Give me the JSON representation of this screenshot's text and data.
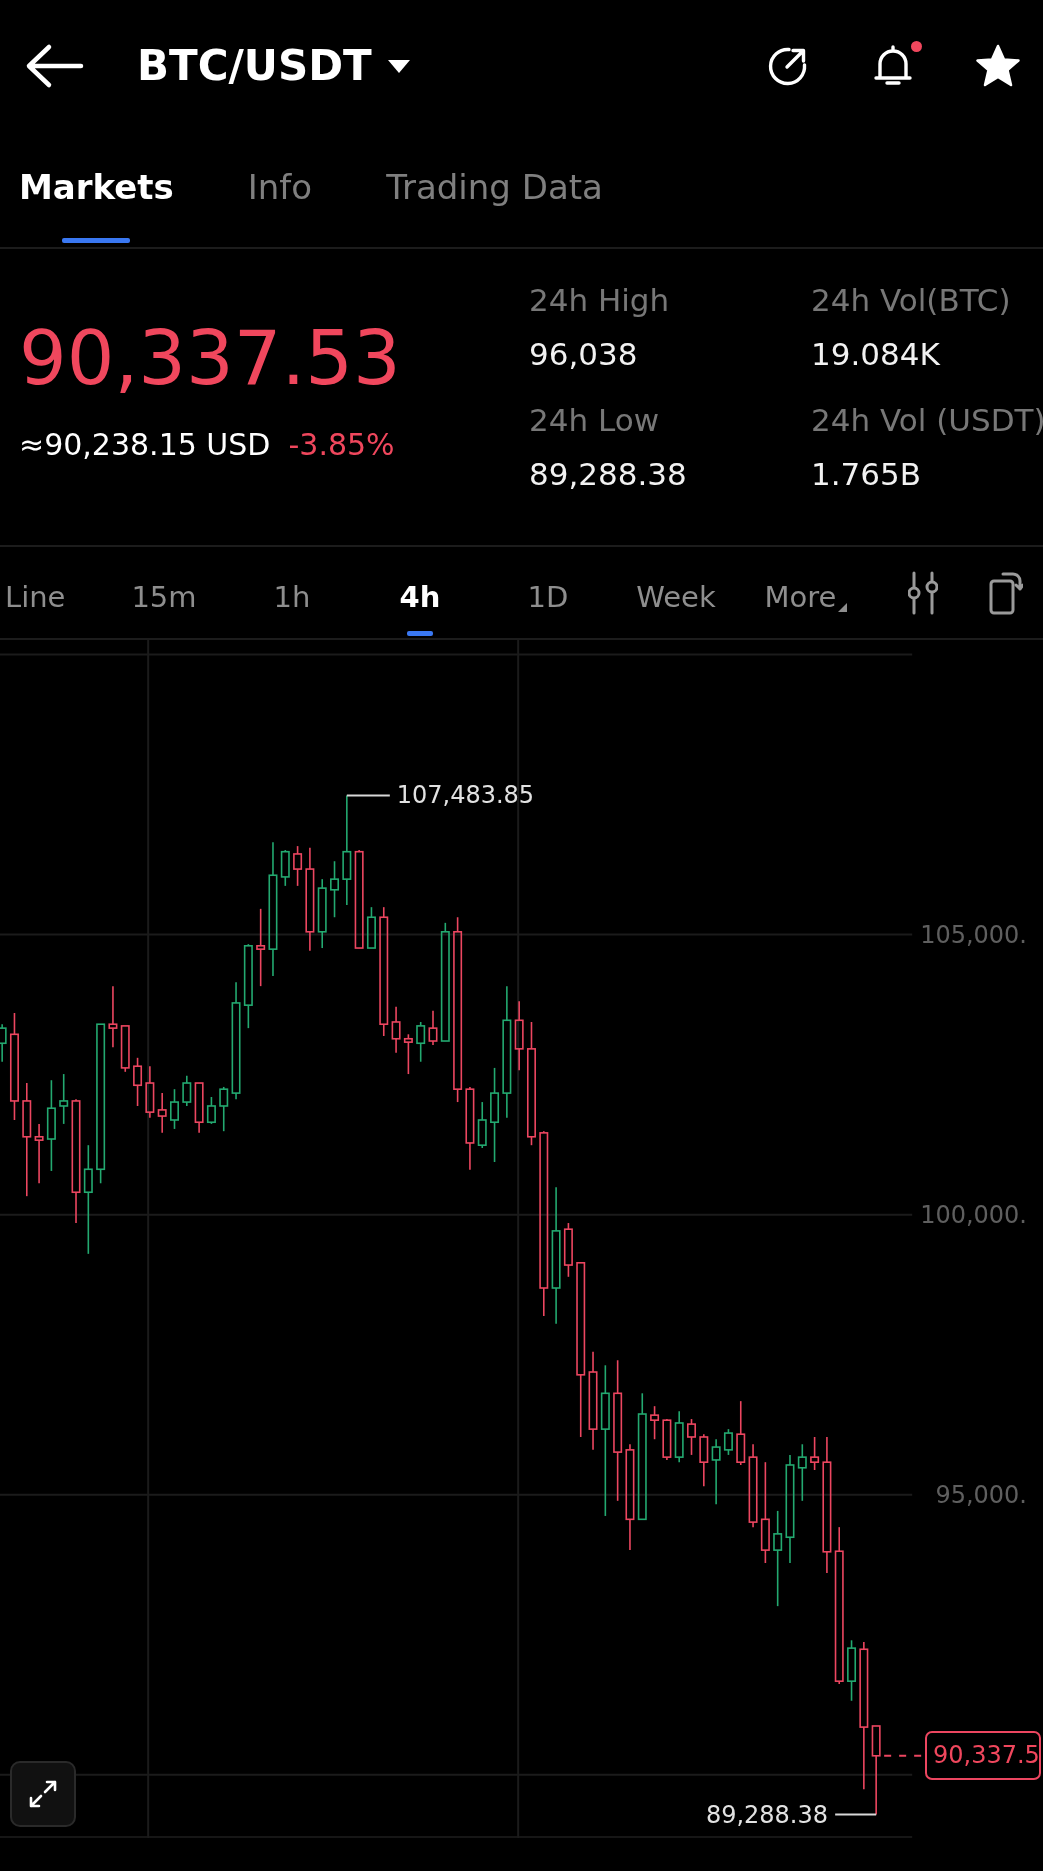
{
  "header": {
    "title": "BTC/USDT",
    "notification_dot": true,
    "favorite": true
  },
  "tabs": [
    {
      "label": "Markets",
      "selected": true
    },
    {
      "label": "Info",
      "selected": false
    },
    {
      "label": "Trading Data",
      "selected": false
    }
  ],
  "ticker": {
    "falling": true,
    "last_price": "90,337.53",
    "usd_value": "≈90,238.15 USD",
    "change": "-3.85%",
    "stats": [
      {
        "label": "24h High",
        "value": "96,038"
      },
      {
        "label": "24h Vol(BTC)",
        "value": "19.084K"
      },
      {
        "label": "24h Low",
        "value": "89,288.38"
      },
      {
        "label": "24h Vol (USDT)",
        "value": "1.765B"
      }
    ]
  },
  "intervals": [
    {
      "label": "Line",
      "selected": false,
      "kind": "option"
    },
    {
      "label": "15m",
      "selected": false,
      "kind": "option"
    },
    {
      "label": "1h",
      "selected": false,
      "kind": "option"
    },
    {
      "label": "4h",
      "selected": true,
      "kind": "option"
    },
    {
      "label": "1D",
      "selected": false,
      "kind": "option"
    },
    {
      "label": "Week",
      "selected": false,
      "kind": "option"
    },
    {
      "label": "More",
      "selected": false,
      "kind": "menu"
    }
  ],
  "chart": {
    "chart_data": {
      "type": "candlestick",
      "grid": true,
      "ohlc": [
        [
          103060,
          103400,
          102730,
          103330
        ],
        [
          103220,
          103600,
          101690,
          102030
        ],
        [
          102030,
          102350,
          100330,
          101390
        ],
        [
          101390,
          101620,
          100560,
          101330
        ],
        [
          101350,
          102400,
          100780,
          101900
        ],
        [
          101940,
          102510,
          101620,
          102030
        ],
        [
          102030,
          102060,
          99850,
          100400
        ],
        [
          100400,
          101240,
          99300,
          100810
        ],
        [
          100810,
          103400,
          100560,
          103400
        ],
        [
          103400,
          104080,
          102990,
          103330
        ],
        [
          103370,
          103370,
          102550,
          102620
        ],
        [
          102650,
          102800,
          101940,
          102310
        ],
        [
          102350,
          102650,
          101730,
          101830
        ],
        [
          101870,
          102170,
          101460,
          101760
        ],
        [
          101690,
          102240,
          101530,
          102010
        ],
        [
          102010,
          102480,
          101940,
          102350
        ],
        [
          102350,
          102350,
          101460,
          101650
        ],
        [
          101650,
          102100,
          101620,
          101940
        ],
        [
          101940,
          102280,
          101490,
          102240
        ],
        [
          102170,
          104150,
          102060,
          103780
        ],
        [
          103740,
          104830,
          103330,
          104800
        ],
        [
          104800,
          105460,
          104080,
          104740
        ],
        [
          104740,
          106650,
          104260,
          106060
        ],
        [
          106030,
          106510,
          105870,
          106480
        ],
        [
          106440,
          106580,
          105870,
          106170
        ],
        [
          106170,
          106550,
          104710,
          105050
        ],
        [
          105050,
          105990,
          104760,
          105830
        ],
        [
          105800,
          106310,
          105310,
          105990
        ],
        [
          105990,
          107483.85,
          105530,
          106480
        ],
        [
          106480,
          106510,
          104760,
          104760
        ],
        [
          104760,
          105490,
          104760,
          105310
        ],
        [
          105310,
          105490,
          103190,
          103400
        ],
        [
          103440,
          103710,
          102890,
          103140
        ],
        [
          103140,
          103220,
          102510,
          103080
        ],
        [
          103060,
          103440,
          102730,
          103370
        ],
        [
          103330,
          103640,
          103030,
          103100
        ],
        [
          103100,
          105210,
          103100,
          105050
        ],
        [
          105050,
          105310,
          102010,
          102240
        ],
        [
          102240,
          102280,
          100800,
          101280
        ],
        [
          101240,
          102010,
          101190,
          101690
        ],
        [
          101650,
          102620,
          100940,
          102170
        ],
        [
          102170,
          104080,
          101730,
          103470
        ],
        [
          103470,
          103810,
          102580,
          102960
        ],
        [
          102960,
          103440,
          101240,
          101390
        ],
        [
          101460,
          101490,
          98190,
          98690
        ],
        [
          98690,
          100490,
          98050,
          99710
        ],
        [
          99740,
          99850,
          98890,
          99100
        ],
        [
          99140,
          99150,
          96030,
          97140
        ],
        [
          97190,
          97550,
          95800,
          96170
        ],
        [
          96170,
          97310,
          94620,
          96810
        ],
        [
          96810,
          97400,
          94890,
          95760
        ],
        [
          95800,
          95900,
          94010,
          94560
        ],
        [
          94560,
          96810,
          94560,
          96440
        ],
        [
          96420,
          96580,
          95990,
          96330
        ],
        [
          96330,
          96350,
          95620,
          95670
        ],
        [
          95670,
          96490,
          95580,
          96280
        ],
        [
          96260,
          96350,
          95710,
          96030
        ],
        [
          96030,
          96080,
          95150,
          95580
        ],
        [
          95620,
          95990,
          94830,
          95850
        ],
        [
          95800,
          96170,
          95710,
          96100
        ],
        [
          96080,
          96670,
          95530,
          95580
        ],
        [
          95670,
          95900,
          94420,
          94510
        ],
        [
          94560,
          95580,
          93780,
          94010
        ],
        [
          94010,
          94710,
          93010,
          94300
        ],
        [
          94240,
          95710,
          93780,
          95530
        ],
        [
          95480,
          95900,
          94890,
          95670
        ],
        [
          95670,
          96030,
          95440,
          95580
        ],
        [
          95580,
          96030,
          93600,
          93980
        ],
        [
          93990,
          94420,
          91620,
          91670
        ],
        [
          91670,
          92400,
          91320,
          92260
        ],
        [
          92240,
          92370,
          89740,
          90850
        ],
        [
          90870,
          90870,
          89288.38,
          90337.53
        ]
      ],
      "ylim": [
        88870,
        110260
      ],
      "yticks": [
        {
          "value": 105000,
          "label": "105,000."
        },
        {
          "value": 100000,
          "label": "100,000."
        },
        {
          "value": 95000,
          "label": "95,000."
        }
      ],
      "annotations": [
        "107,483.85",
        "89,288.38",
        "90,337.5"
      ]
    }
  }
}
